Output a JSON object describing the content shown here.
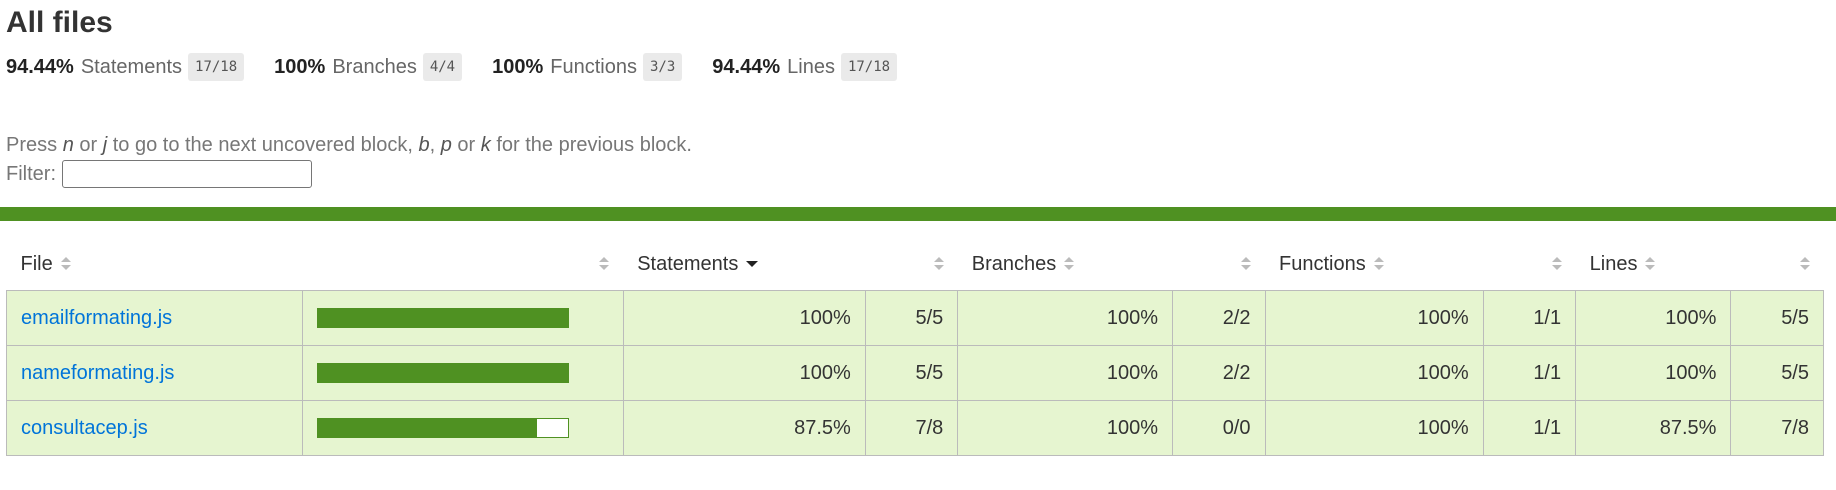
{
  "page": {
    "title": "All files"
  },
  "summary": {
    "statements": {
      "pct": "94.44%",
      "label": "Statements",
      "fraction": "17/18"
    },
    "branches": {
      "pct": "100%",
      "label": "Branches",
      "fraction": "4/4"
    },
    "functions": {
      "pct": "100%",
      "label": "Functions",
      "fraction": "3/3"
    },
    "lines": {
      "pct": "94.44%",
      "label": "Lines",
      "fraction": "17/18"
    }
  },
  "hint": {
    "press": "Press ",
    "key_n": "n",
    "or1": " or ",
    "key_j": "j",
    "mid": " to go to the next uncovered block, ",
    "key_b": "b",
    "comma": ", ",
    "key_p": "p",
    "or2": " or ",
    "key_k": "k",
    "end": " for the previous block."
  },
  "filter": {
    "label": "Filter:",
    "value": ""
  },
  "colors": {
    "high_coverage": "#4f9122",
    "row_background": "#e6f5d0",
    "link": "#0074d9"
  },
  "table": {
    "headers": {
      "file": "File",
      "statements": "Statements",
      "branches": "Branches",
      "functions": "Functions",
      "lines": "Lines"
    },
    "sorted_column": "statements",
    "sort_direction": "descending",
    "rows": [
      {
        "file": "emailformating.js",
        "coverage_fraction": 1.0,
        "statements_pct": "100%",
        "statements_frac": "5/5",
        "branches_pct": "100%",
        "branches_frac": "2/2",
        "functions_pct": "100%",
        "functions_frac": "1/1",
        "lines_pct": "100%",
        "lines_frac": "5/5"
      },
      {
        "file": "nameformating.js",
        "coverage_fraction": 1.0,
        "statements_pct": "100%",
        "statements_frac": "5/5",
        "branches_pct": "100%",
        "branches_frac": "2/2",
        "functions_pct": "100%",
        "functions_frac": "1/1",
        "lines_pct": "100%",
        "lines_frac": "5/5"
      },
      {
        "file": "consultacep.js",
        "coverage_fraction": 0.875,
        "statements_pct": "87.5%",
        "statements_frac": "7/8",
        "branches_pct": "100%",
        "branches_frac": "0/0",
        "functions_pct": "100%",
        "functions_frac": "1/1",
        "lines_pct": "87.5%",
        "lines_frac": "7/8"
      }
    ]
  }
}
